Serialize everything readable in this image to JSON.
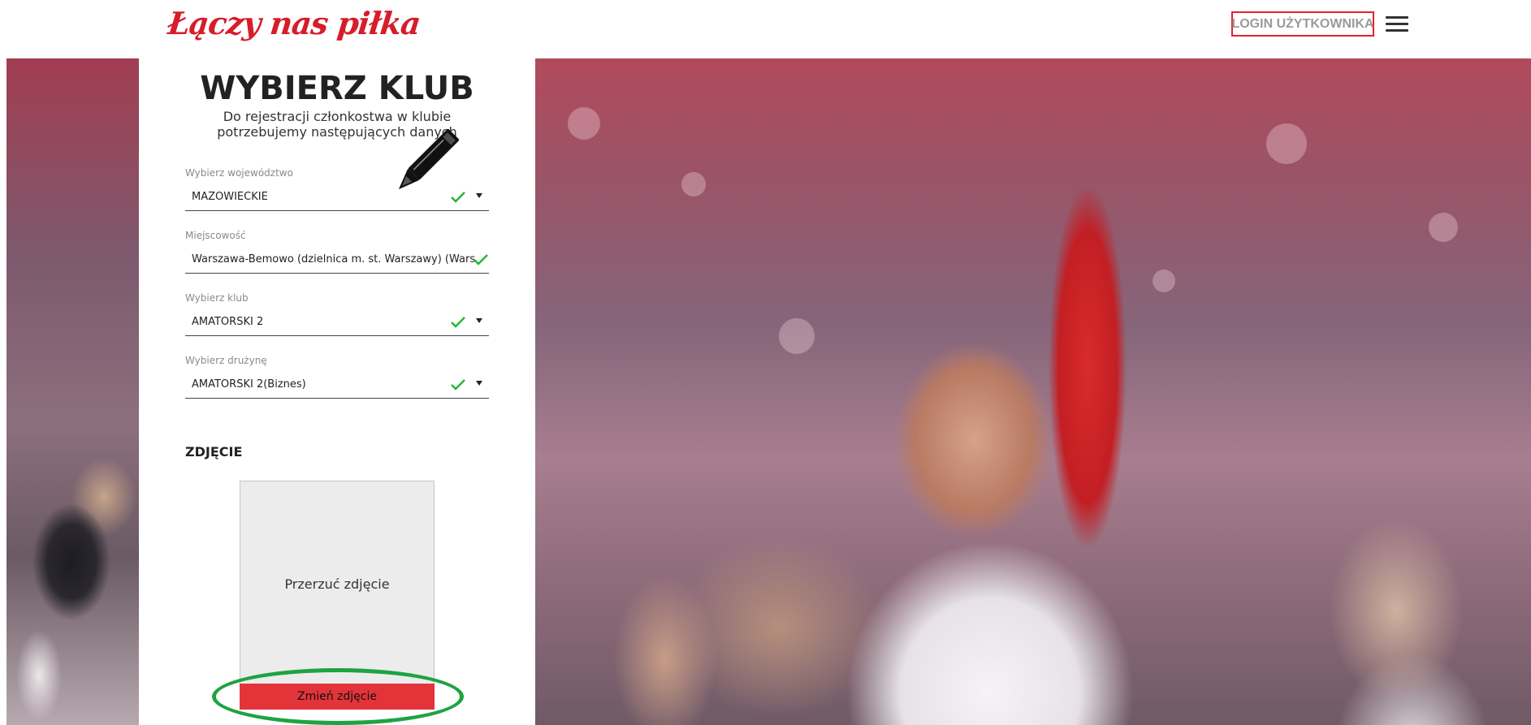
{
  "header": {
    "logo_text": "Łączy nas piłka",
    "login_label": "LOGIN UŻYTKOWNIKA",
    "menu_icon": "hamburger-icon"
  },
  "form": {
    "title": "WYBIERZ KLUB",
    "subtitle": "Do rejestracji członkostwa w klubie potrzebujemy następujących danych",
    "fields": [
      {
        "label": "Wybierz województwo",
        "value": "MAZOWIECKIE",
        "valid": true,
        "dropdown": true
      },
      {
        "label": "Miejscowość",
        "value": "Warszawa-Bemowo (dzielnica m. st. Warszawy) (Warsza...",
        "valid": true,
        "dropdown": false
      },
      {
        "label": "Wybierz klub",
        "value": "AMATORSKI 2",
        "valid": true,
        "dropdown": true
      },
      {
        "label": "Wybierz drużynę",
        "value": "AMATORSKI 2(Biznes)",
        "valid": true,
        "dropdown": true
      }
    ],
    "photo_heading": "ZDJĘCIE",
    "dropzone_text": "Przerzuć zdjęcie",
    "change_photo_label": "Zmień zdjęcie"
  },
  "colors": {
    "brand_red": "#d71c2a",
    "check_green": "#21b533",
    "highlight_green": "#1ea342",
    "button_red": "#e3343a"
  },
  "annotations": {
    "pencil_icon": "pencil-icon",
    "highlight": "green-ellipse-highlight"
  }
}
